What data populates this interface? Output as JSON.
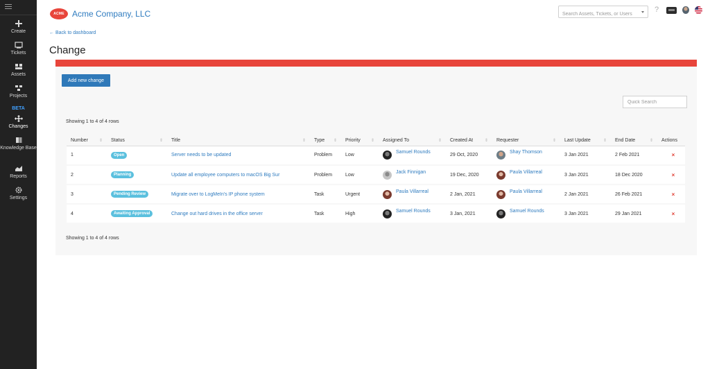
{
  "sidebar": {
    "items": [
      {
        "label": "Create",
        "icon": "plus-icon"
      },
      {
        "label": "Tickets",
        "icon": "monitor-icon"
      },
      {
        "label": "Assets",
        "icon": "assets-icon"
      },
      {
        "label": "Projects",
        "icon": "projects-icon"
      },
      {
        "label": "Changes",
        "icon": "changes-icon"
      },
      {
        "label": "Knowledge Base",
        "icon": "book-icon"
      },
      {
        "label": "Reports",
        "icon": "chart-icon"
      },
      {
        "label": "Settings",
        "icon": "gear-icon"
      }
    ],
    "beta_label": "BETA",
    "active": "Changes"
  },
  "header": {
    "logo_text": "ACME",
    "company": "Acme Company, LLC",
    "search_placeholder": "Search Assets, Tickets, or Users",
    "help_label": "?"
  },
  "page": {
    "back_link": "← Back to dashboard",
    "title": "Change",
    "add_button": "Add new change",
    "quick_search_placeholder": "Quick Search",
    "showing_top": "Showing 1 to 4 of 4 rows",
    "showing_bottom": "Showing 1 to 4 of 4 rows"
  },
  "colors": {
    "accent_red": "#e8453b",
    "primary_blue": "#2f79b9",
    "link_blue": "#2e7bbf",
    "badge_blue": "#5bc0de",
    "sidebar_bg": "#222222"
  },
  "table": {
    "columns": [
      "Number",
      "Status",
      "Title",
      "Type",
      "Priority",
      "Assigned To",
      "Created At",
      "Requester",
      "Last Update",
      "End Date",
      "Actions"
    ],
    "rows": [
      {
        "number": "1",
        "status": "Open",
        "title": "Server needs to be updated",
        "type": "Problem",
        "priority": "Low",
        "assigned": "Samuel Rounds",
        "created": "29 Oct, 2020",
        "requester": "Shay Thomson",
        "last_update": "3 Jan 2021",
        "end_date": "2 Feb 2021",
        "action": "×"
      },
      {
        "number": "2",
        "status": "Planning",
        "title": "Update all employee computers to macOS Big Sur",
        "type": "Problem",
        "priority": "Low",
        "assigned": "Jack Finnigan",
        "created": "19 Dec, 2020",
        "requester": "Paula Villarreal",
        "last_update": "3 Jan 2021",
        "end_date": "18 Dec 2020",
        "action": "×"
      },
      {
        "number": "3",
        "status": "Pending Review",
        "title": "Migrate over to LogMeIn's IP phone system",
        "type": "Task",
        "priority": "Urgent",
        "assigned": "Paula Villarreal",
        "created": "2 Jan, 2021",
        "requester": "Paula Villarreal",
        "last_update": "2 Jan 2021",
        "end_date": "26 Feb 2021",
        "action": "×"
      },
      {
        "number": "4",
        "status": "Awaiting Approval",
        "title": "Change out hard drives in the office server",
        "type": "Task",
        "priority": "High",
        "assigned": "Samuel Rounds",
        "created": "3 Jan, 2021",
        "requester": "Samuel Rounds",
        "last_update": "3 Jan 2021",
        "end_date": "29 Jan 2021",
        "action": "×"
      }
    ]
  }
}
